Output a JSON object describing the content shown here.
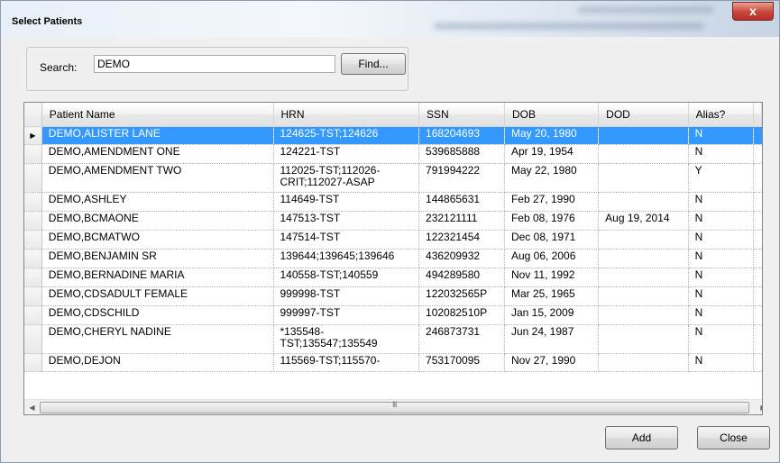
{
  "window": {
    "title": "Select Patients",
    "close_glyph": "x"
  },
  "search": {
    "label": "Search:",
    "value": "DEMO",
    "find_label": "Find..."
  },
  "grid": {
    "columns": [
      "Patient Name",
      "HRN",
      "SSN",
      "DOB",
      "DOD",
      "Alias?"
    ],
    "selected_row": 0,
    "rows": [
      [
        "DEMO,ALISTER LANE",
        "124625-TST;124626",
        "168204693",
        "May 20, 1980",
        "",
        "N"
      ],
      [
        "DEMO,AMENDMENT ONE",
        "124221-TST",
        "539685888",
        "Apr 19, 1954",
        "",
        "N"
      ],
      [
        "DEMO,AMENDMENT TWO",
        "112025-TST;112026-CRIT;112027-ASAP",
        "791994222",
        "May 22, 1980",
        "",
        "Y"
      ],
      [
        "DEMO,ASHLEY",
        "114649-TST",
        "144865631",
        "Feb 27, 1990",
        "",
        "N"
      ],
      [
        "DEMO,BCMAONE",
        "147513-TST",
        "232121111",
        "Feb 08, 1976",
        "Aug 19, 2014",
        "N"
      ],
      [
        "DEMO,BCMATWO",
        "147514-TST",
        "122321454",
        "Dec 08, 1971",
        "",
        "N"
      ],
      [
        "DEMO,BENJAMIN SR",
        "139644;139645;139646",
        "436209932",
        "Aug 06, 2006",
        "",
        "N"
      ],
      [
        "DEMO,BERNADINE MARIA",
        "140558-TST;140559",
        "494289580",
        "Nov 11, 1992",
        "",
        "N"
      ],
      [
        "DEMO,CDSADULT FEMALE",
        "999998-TST",
        "122032565P",
        "Mar 25, 1965",
        "",
        "N"
      ],
      [
        "DEMO,CDSCHILD",
        "999997-TST",
        "102082510P",
        "Jan 15, 2009",
        "",
        "N"
      ],
      [
        "DEMO,CHERYL NADINE",
        "*135548-TST;135547;135549",
        "246873731",
        "Jun 24, 1987",
        "",
        "N"
      ],
      [
        "DEMO,DEJON",
        "115569-TST;115570-",
        "753170095",
        "Nov 27, 1990",
        "",
        "N"
      ]
    ],
    "hscroll_grip": "III"
  },
  "buttons": {
    "add_label": "Add",
    "close_label": "Close"
  }
}
